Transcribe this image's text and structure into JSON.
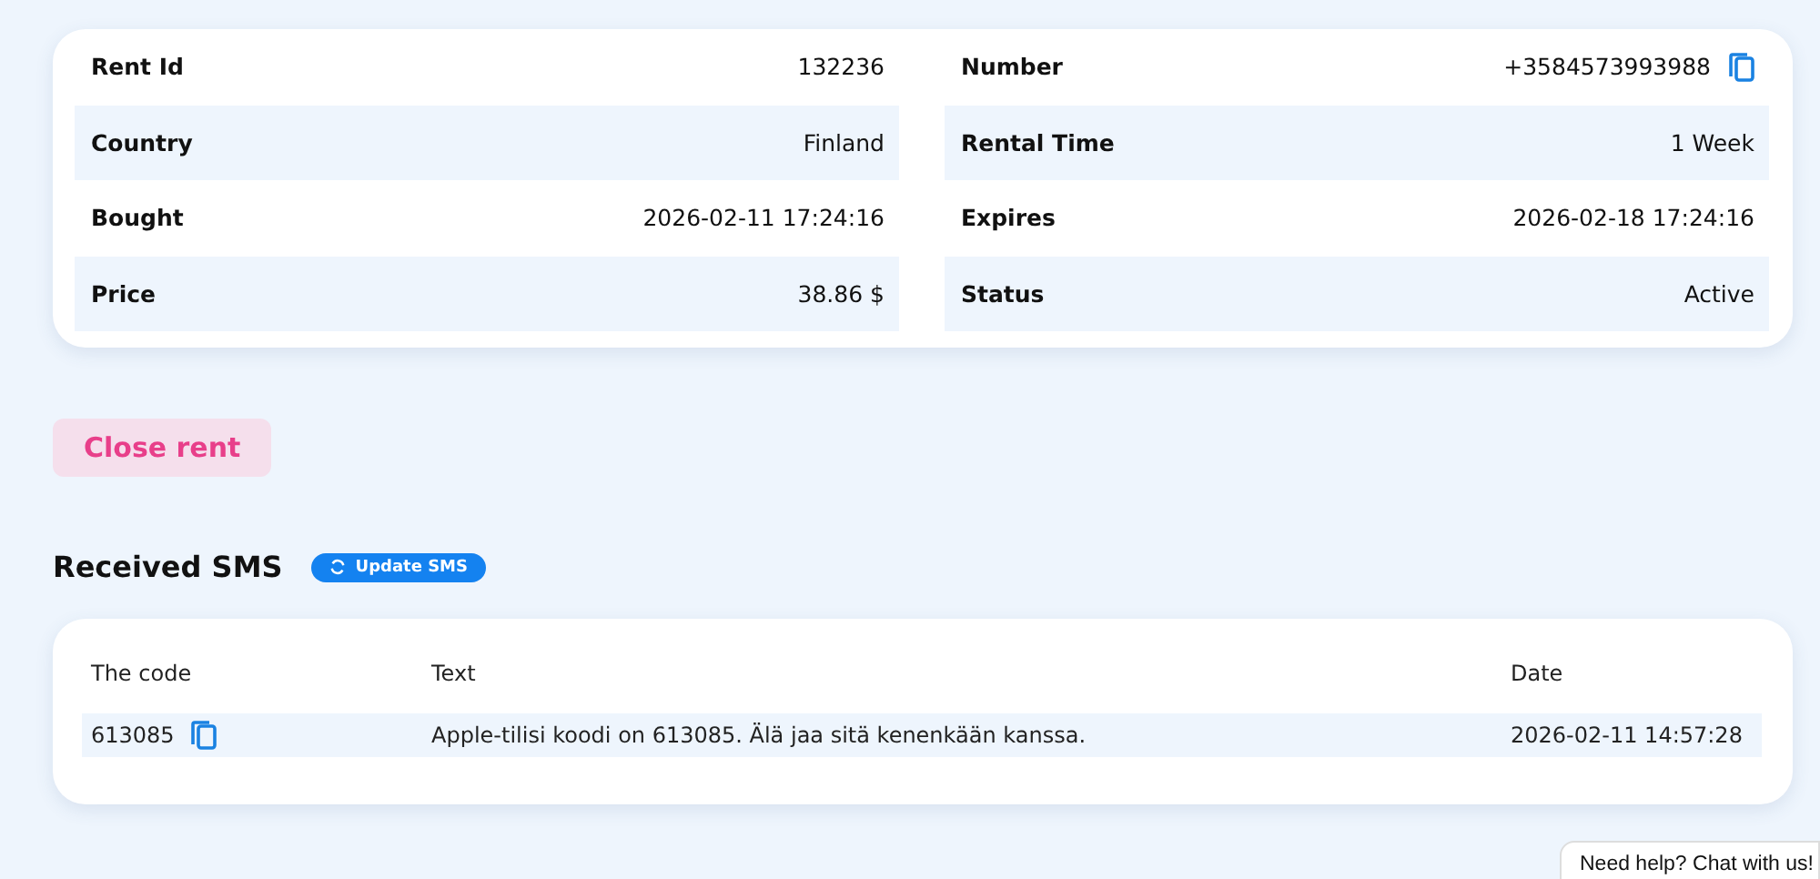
{
  "rent_details": {
    "columns": [
      [
        {
          "label": "Rent Id",
          "value": "132236"
        },
        {
          "label": "Country",
          "value": "Finland"
        },
        {
          "label": "Bought",
          "value": "2026-02-11 17:24:16"
        },
        {
          "label": "Price",
          "value": "38.86 $"
        }
      ],
      [
        {
          "label": "Number",
          "value": "+3584573993988",
          "copyable": true
        },
        {
          "label": "Rental Time",
          "value": "1 Week"
        },
        {
          "label": "Expires",
          "value": "2026-02-18 17:24:16"
        },
        {
          "label": "Status",
          "value": "Active"
        }
      ]
    ]
  },
  "close_button": "Close rent",
  "sms": {
    "title": "Received SMS",
    "update_button": "Update SMS",
    "table": {
      "columns": [
        "The code",
        "Text",
        "Date"
      ],
      "rows": [
        {
          "code": "613085",
          "text": "Apple-tilisi koodi on 613085. Älä jaa sitä kenenkään kanssa.",
          "date": "2026-02-11 14:57:28"
        }
      ]
    }
  },
  "chat_widget": "Need help? Chat with us!"
}
